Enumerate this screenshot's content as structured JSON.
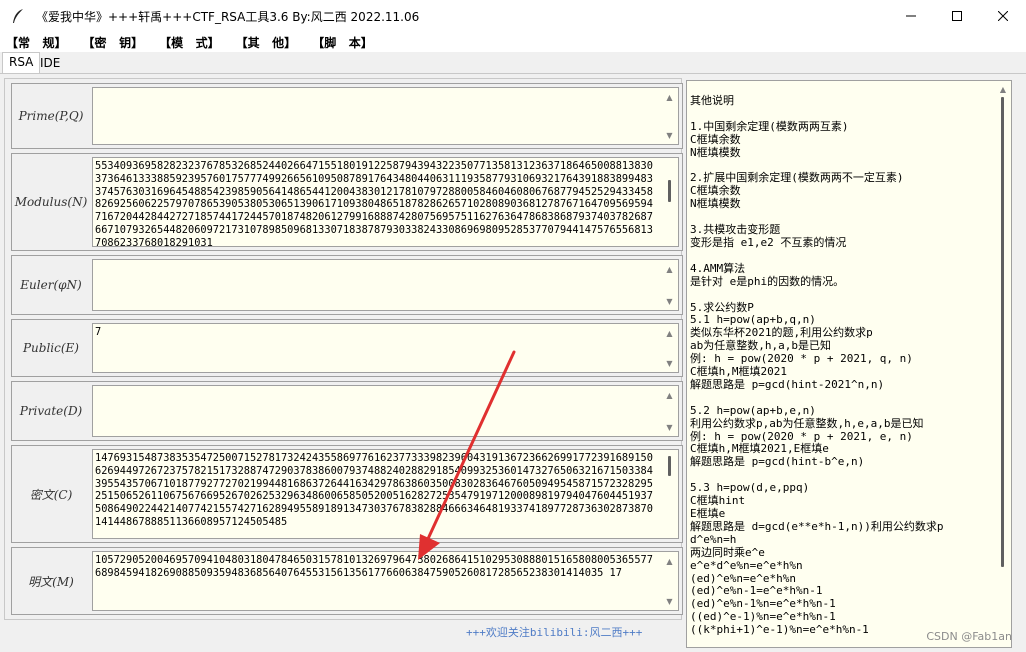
{
  "window": {
    "title": "《爱我中华》+++轩禹+++CTF_RSA工具3.6   By:风二西 2022.11.06",
    "minimize_icon": "minimize-icon",
    "maximize_icon": "maximize-icon",
    "close_icon": "close-icon"
  },
  "menu": [
    "【常   规】",
    "【密   钥】",
    "【模   式】",
    "【其   他】",
    "【脚   本】"
  ],
  "tabs": [
    {
      "label": "RSA",
      "active": true
    },
    {
      "label": "IDE",
      "active": false
    }
  ],
  "fields": {
    "prime": {
      "label": "Prime(P,Q)",
      "value": ""
    },
    "modulus": {
      "label": "Modulus(N)",
      "value": "5534093695828232376785326852440266471551801912258794394322350771358131236371864650088138303736461333885923957601757774992665610950878917643480440631119358779310693217643918838994833745763031696454885423985905641486544120043830121781079728800584604608067687794525294334588269256062257970786539053805306513906171093804865187828626571028089036812787671647095695947167204428442727185744172445701874820612799168887428075695751162763647868386879374037826876671079326544820609721731078985096813307183878793033824330869698095285377079441475765568137086233768018291031"
    },
    "euler": {
      "label": "Euler(φN)",
      "value": ""
    },
    "public": {
      "label": "Public(E)",
      "value": "7"
    },
    "private": {
      "label": "Private(D)",
      "value": ""
    },
    "cipher": {
      "label": "密文(C)",
      "value": "1476931548738353547250071527817324243558697761623773339823960431913672366269917723916891506269449726723757821517328874729037838600793748824028829185409932536014732765063216715033843955435706710187792772702199448168637264416342978638603500830283646760509495458715723282952515065261106756766952670262532963486006585052005162827253547919712000898197940476044519375086490224421407742155742716289495589189134730376783828846663464819337418977287363028738701414486788851136608957124505485"
    },
    "plain": {
      "label": "明文(M)",
      "value": "1057290520046957094104803180478465031578101326979647380268641510295308880151658080053655776898459418269088509359483685640764553156135617766063847590526081728565238301414035 17"
    }
  },
  "footer": "+++欢迎关注bilibili:风二西+++",
  "notes": "其他说明\n\n1.中国剩余定理(模数两两互素)\nC框填余数\nN框填模数\n\n2.扩展中国剩余定理(模数两两不一定互素)\nC框填余数\nN框填模数\n\n3.共模攻击变形题\n变形是指 e1,e2 不互素的情况\n\n4.AMM算法\n是针对 e是phi的因数的情况。\n\n5.求公约数P\n5.1 h=pow(ap+b,q,n)\n类似东华杯2021的题,利用公约数求p\nab为任意整数,h,a,b是已知\n例: h = pow(2020 * p + 2021, q, n)\nC框填h,M框填2021\n解题思路是 p=gcd(hint-2021^n,n)\n\n5.2 h=pow(ap+b,e,n)\n利用公约数求p,ab为任意整数,h,e,a,b是已知\n例: h = pow(2020 * p + 2021, e, n)\nC框填h,M框填2021,E框填e\n解题思路是 p=gcd(hint-b^e,n)\n\n5.3 h=pow(d,e,ppq)\nC框填hint\nE框填e\n解题思路是 d=gcd(e**e*h-1,n))利用公约数求p\nd^e%n=h\n两边同时乘e^e\ne^e*d^e%n=e^e*h%n\n(ed)^e%n=e^e*h%n\n(ed)^e%n-1=e^e*h%n-1\n(ed)^e%n-1%n=e^e*h%n-1\n((ed)^e-1)%n=e^e*h%n-1\n((k*phi+1)^e-1)%n=e^e*h%n-1",
  "watermark": "CSDN @Fab1an"
}
